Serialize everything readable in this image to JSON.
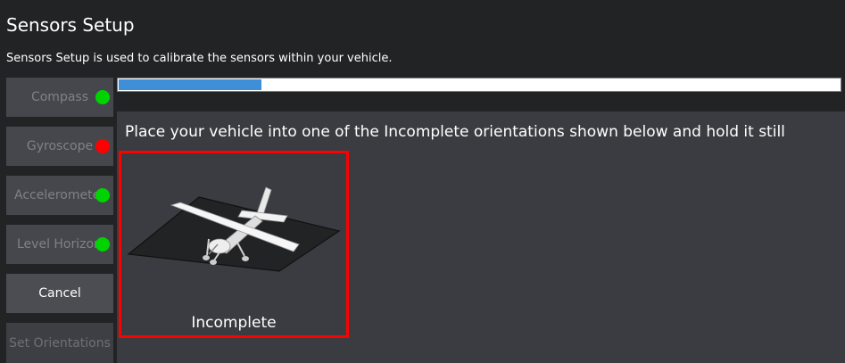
{
  "header": {
    "title": "Sensors Setup",
    "subtitle": "Sensors Setup is used to calibrate the sensors within your vehicle."
  },
  "sidebar": {
    "items": [
      {
        "label": "Compass",
        "status": "complete",
        "status_color": "#00d400"
      },
      {
        "label": "Gyroscope",
        "status": "error",
        "status_color": "#ff0000"
      },
      {
        "label": "Accelerometer",
        "status": "complete",
        "status_color": "#00d400"
      },
      {
        "label": "Level Horizon",
        "status": "complete",
        "status_color": "#00d400"
      }
    ],
    "cancel_label": "Cancel",
    "set_orientations_label": "Set Orientations"
  },
  "calibration": {
    "progress_fraction": 0.2,
    "instruction": "Place your vehicle into one of the Incomplete orientations shown below and hold it still",
    "orientations": [
      {
        "label": "Incomplete",
        "icon": "airplane-icon",
        "highlight_color": "#ff0000"
      }
    ]
  },
  "colors": {
    "background": "#222325",
    "panel": "#3a3c41",
    "button": "#45474c",
    "progress_fill": "#3f8fd8",
    "highlight": "#ff0000"
  }
}
